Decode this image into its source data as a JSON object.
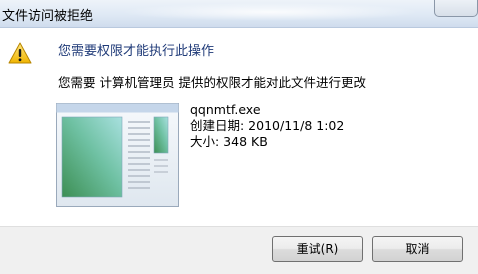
{
  "window": {
    "title": "文件访问被拒绝"
  },
  "dialog": {
    "heading": "您需要权限才能执行此操作",
    "message": "您需要 计算机管理员 提供的权限才能对此文件进行更改",
    "icon": "warning-icon"
  },
  "file": {
    "name": "qqnmtf.exe",
    "created": "创建日期: 2010/11/8 1:02",
    "size": "大小: 348 KB"
  },
  "buttons": {
    "retry": "重试(R)",
    "cancel": "取消"
  },
  "colors": {
    "heading": "#1f3a78",
    "warning": "#f2c21b"
  }
}
